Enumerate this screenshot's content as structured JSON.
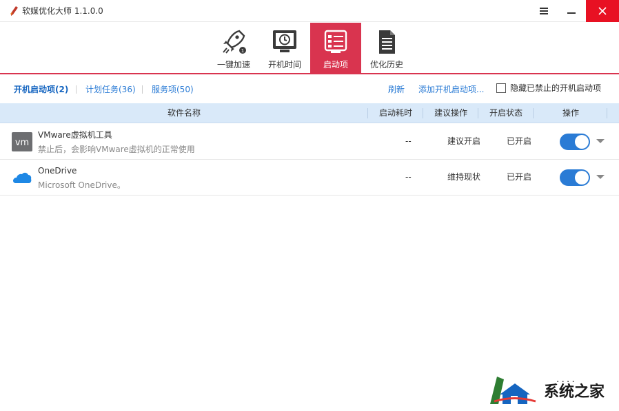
{
  "window": {
    "title": "软媒优化大师 1.1.0.0"
  },
  "toolbar": {
    "items": [
      {
        "label": "一键加速",
        "icon": "rocket-icon"
      },
      {
        "label": "开机时间",
        "icon": "clock-monitor-icon"
      },
      {
        "label": "启动项",
        "icon": "startup-list-icon",
        "active": true
      },
      {
        "label": "优化历史",
        "icon": "document-icon"
      }
    ]
  },
  "subtabs": {
    "items": [
      {
        "label": "开机启动项(2)",
        "active": true
      },
      {
        "label": "计划任务(36)"
      },
      {
        "label": "服务项(50)"
      }
    ],
    "refresh": "刷新",
    "add_startup": "添加开机启动项...",
    "hide_disabled": "隐藏已禁止的开机启动项",
    "hide_disabled_checked": false
  },
  "table": {
    "columns": [
      "软件名称",
      "启动耗时",
      "建议操作",
      "开启状态",
      "操作"
    ],
    "rows": [
      {
        "name": "VMware虚拟机工具",
        "desc": "禁止后，会影响VMware虚拟机的正常使用",
        "time": "--",
        "suggest": "建议开启",
        "status": "已开启",
        "icon": "vmware-icon",
        "enabled": true
      },
      {
        "name": "OneDrive",
        "desc": "Microsoft OneDrive。",
        "time": "--",
        "suggest": "维持现状",
        "status": "已开启",
        "icon": "onedrive-cloud-icon",
        "enabled": true
      }
    ]
  },
  "watermark": {
    "text": "系统之家",
    "dots": "...."
  },
  "colors": {
    "accent_red": "#d9344f",
    "link_blue": "#2a7bd5",
    "header_blue": "#d9e9f9",
    "close_red": "#e81123"
  }
}
